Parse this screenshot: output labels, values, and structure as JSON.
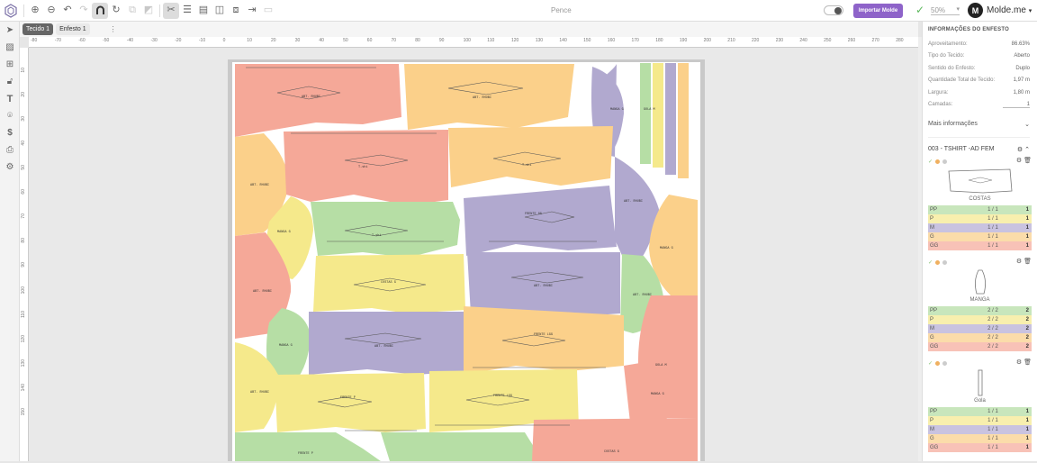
{
  "app": {
    "document_title": "Pence",
    "brand": "Molde.me",
    "avatar_letter": "M",
    "import_label": "Importar Molde",
    "zoom": "50%"
  },
  "tabs": [
    {
      "label": "Tecido 1"
    },
    {
      "label": "Enfesto 1"
    }
  ],
  "tab_menu": "⋮",
  "ruler": {
    "h": [
      "-80",
      "-70",
      "-60",
      "-50",
      "-40",
      "-30",
      "-20",
      "-10",
      "0",
      "10",
      "20",
      "30",
      "40",
      "50",
      "60",
      "70",
      "80",
      "90",
      "100",
      "110",
      "120",
      "130",
      "140",
      "150",
      "160",
      "170",
      "180",
      "190",
      "200",
      "210",
      "220",
      "230",
      "240",
      "250",
      "260",
      "270",
      "280"
    ],
    "v": [
      "10",
      "20",
      "30",
      "40",
      "50",
      "60",
      "70",
      "80",
      "90",
      "100",
      "110",
      "120",
      "130",
      "140",
      "150"
    ]
  },
  "panel": {
    "title": "INFORMAÇÕES DO ENFESTO",
    "rows": [
      {
        "label": "Aproveitamento:",
        "value": "86.63%"
      },
      {
        "label": "Tipo do Tecido:",
        "value": "Aberto"
      },
      {
        "label": "Sentido do Enfesto:",
        "value": "Duplo"
      },
      {
        "label": "Quantidade Total de Tecido:",
        "value": "1,97 m"
      },
      {
        "label": "Largura:",
        "value": "1,80 m"
      },
      {
        "label": "Camadas:",
        "value": "1"
      }
    ],
    "more": "Mais informações",
    "group": "003 - TSHIRT -AD FEM",
    "cards": [
      {
        "name": "COSTAS",
        "sizes": [
          {
            "s": "PP",
            "q": "1  /  1",
            "t": "1"
          },
          {
            "s": "P",
            "q": "1  /  1",
            "t": "1"
          },
          {
            "s": "M",
            "q": "1  /  1",
            "t": "1"
          },
          {
            "s": "G",
            "q": "1  /  1",
            "t": "1"
          },
          {
            "s": "GG",
            "q": "1  /  1",
            "t": "1"
          }
        ]
      },
      {
        "name": "MANGA",
        "sizes": [
          {
            "s": "PP",
            "q": "2  /  2",
            "t": "2"
          },
          {
            "s": "P",
            "q": "2  /  2",
            "t": "2"
          },
          {
            "s": "M",
            "q": "2  /  2",
            "t": "2"
          },
          {
            "s": "G",
            "q": "2  /  2",
            "t": "2"
          },
          {
            "s": "GG",
            "q": "2  /  2",
            "t": "2"
          }
        ]
      },
      {
        "name": "Gola",
        "sizes": [
          {
            "s": "PP",
            "q": "1  /  1",
            "t": "1"
          },
          {
            "s": "P",
            "q": "1  /  1",
            "t": "1"
          },
          {
            "s": "M",
            "q": "1  /  1",
            "t": "1"
          },
          {
            "s": "G",
            "q": "1  /  1",
            "t": "1"
          },
          {
            "s": "GG",
            "q": "1  /  1",
            "t": "1"
          }
        ]
      }
    ]
  },
  "piece_labels": {
    "a": "COSTAS G",
    "b": "FRENTE LGG",
    "c": "MANGA G",
    "d": "GOLA M",
    "e": "FRENTE P",
    "f": "T-shi",
    "g": "FRENTE GG",
    "h": "ABT. RHUBI"
  },
  "colors": {
    "PP": "#b6dea5",
    "P": "#f5e98b",
    "M": "#b1a9cf",
    "G": "#fbd08a",
    "GG": "#f5a898",
    "PP_row": "#c8e6bc",
    "P_row": "#f8efae",
    "M_row": "#c9c3e0",
    "G_row": "#fbdcaa",
    "GG_row": "#f8c2b7",
    "accent": "#8e63c9"
  }
}
